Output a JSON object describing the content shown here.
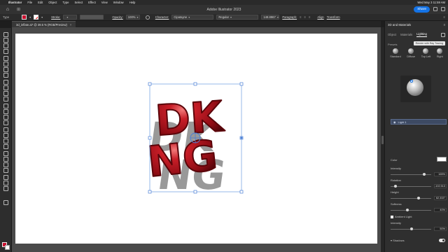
{
  "menubar": {
    "items": [
      "Illustrator",
      "File",
      "Edit",
      "Object",
      "Type",
      "Select",
      "Effect",
      "View",
      "Window",
      "Help"
    ],
    "clock": "Wed May 3  11:59 AM"
  },
  "appbar": {
    "title": "Adobe Illustrator 2023",
    "share_label": "Share"
  },
  "controlbar": {
    "selection_label": "Type",
    "stroke_label": "Stroke:",
    "opacity_label": "Opacity:",
    "opacity_value": "100%",
    "character_label": "Character:",
    "font_value": "Cipatayne",
    "style_value": "Regular",
    "size_value": "148.8967",
    "paragraph_label": "Paragraph:",
    "align_label": "Align",
    "transform_label": "Transform"
  },
  "document": {
    "tab_label": "3d_inflate.ai* @ 39.5 % (RGB/Preview)",
    "art_letters_top": "DK",
    "art_letters_bottom": "NG"
  },
  "panel": {
    "title": "3D and Materials",
    "tabs": [
      "Object",
      "Materials",
      "Lighting"
    ],
    "active_tab": "Lighting",
    "tooltip": "Render with Ray Tracing",
    "presets_label": "Presets",
    "presets": [
      "Standard",
      "Diffuse",
      "Top Left",
      "Right"
    ],
    "light_name": "Light 1",
    "color_label": "Color",
    "intensity_label": "Intensity",
    "intensity_value": "165%",
    "rotation_label": "Rotation",
    "rotation_value": "-102.513",
    "height_label": "Height",
    "height_value": "62.333°",
    "softness_label": "Softness",
    "softness_value": "40%",
    "ambient_label": "Ambient Light",
    "ambient_intensity_label": "Intensity",
    "ambient_intensity_value": "50%",
    "shadows_label": "Shadows"
  },
  "colors": {
    "accent": "#1473e6",
    "fill": "#c8102e",
    "artwork_red": "#9e0f18"
  }
}
